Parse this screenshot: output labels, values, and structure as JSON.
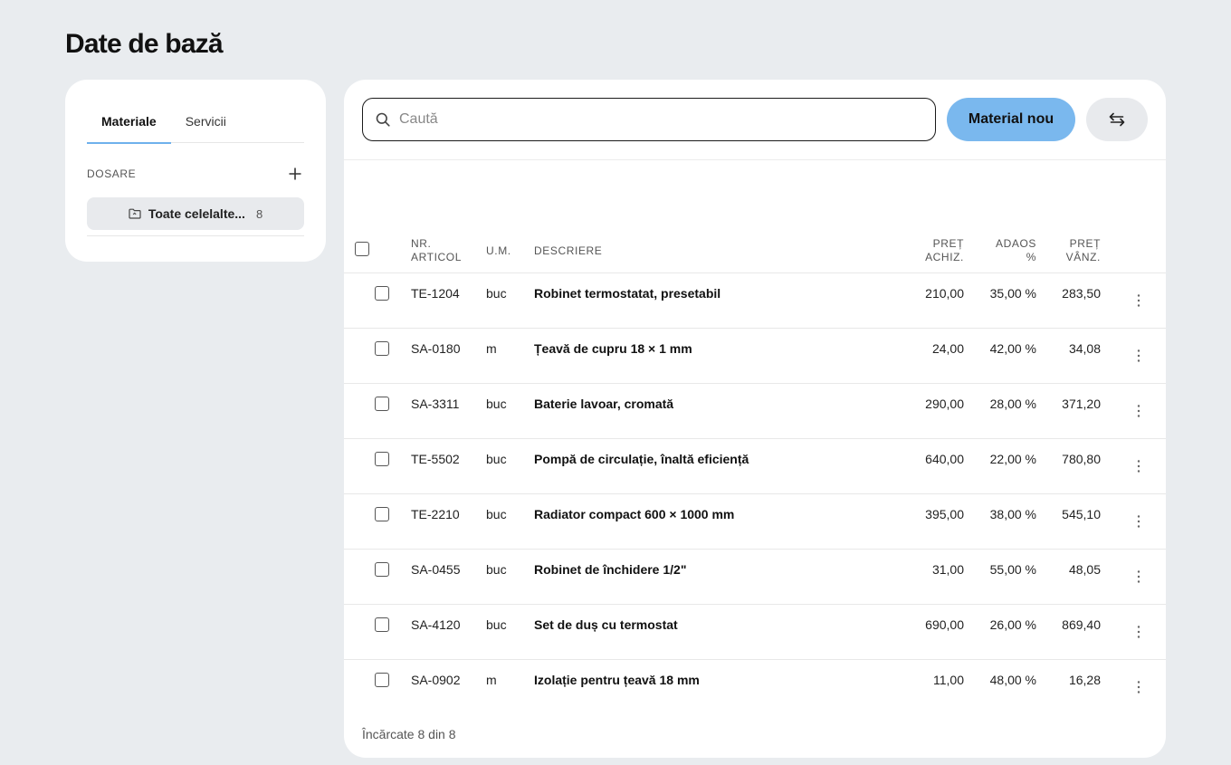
{
  "page": {
    "title": "Date de bază"
  },
  "sidebar": {
    "tabs": [
      {
        "label": "Materiale",
        "active": true
      },
      {
        "label": "Servicii",
        "active": false
      }
    ],
    "folders_label": "DOSARE",
    "folder": {
      "name": "Toate celelalte...",
      "count": "8"
    }
  },
  "toolbar": {
    "search_placeholder": "Caută",
    "new_material_label": "Material nou"
  },
  "table": {
    "headers": {
      "article_1": "NR.",
      "article_2": "ARTICOL",
      "unit": "U.M.",
      "description": "DESCRIERE",
      "buy_1": "PREȚ",
      "buy_2": "ACHIZ.",
      "markup_1": "ADAOS",
      "markup_2": "%",
      "sell_1": "PREȚ",
      "sell_2": "VÂNZ."
    },
    "rows": [
      {
        "article": "TE-1204",
        "unit": "buc",
        "description": "Robinet termostatat, presetabil",
        "buy": "210,00",
        "markup": "35,00 %",
        "sell": "283,50"
      },
      {
        "article": "SA-0180",
        "unit": "m",
        "description": "Țeavă de cupru 18 × 1 mm",
        "buy": "24,00",
        "markup": "42,00 %",
        "sell": "34,08"
      },
      {
        "article": "SA-3311",
        "unit": "buc",
        "description": "Baterie lavoar, cromată",
        "buy": "290,00",
        "markup": "28,00 %",
        "sell": "371,20"
      },
      {
        "article": "TE-5502",
        "unit": "buc",
        "description": "Pompă de circulație, înaltă eficiență",
        "buy": "640,00",
        "markup": "22,00 %",
        "sell": "780,80"
      },
      {
        "article": "TE-2210",
        "unit": "buc",
        "description": "Radiator compact 600 × 1000 mm",
        "buy": "395,00",
        "markup": "38,00 %",
        "sell": "545,10"
      },
      {
        "article": "SA-0455",
        "unit": "buc",
        "description": "Robinet de închidere 1/2\"",
        "buy": "31,00",
        "markup": "55,00 %",
        "sell": "48,05"
      },
      {
        "article": "SA-4120",
        "unit": "buc",
        "description": "Set de duș cu termostat",
        "buy": "690,00",
        "markup": "26,00 %",
        "sell": "869,40"
      },
      {
        "article": "SA-0902",
        "unit": "m",
        "description": "Izolație pentru țeavă 18 mm",
        "buy": "11,00",
        "markup": "48,00 %",
        "sell": "16,28"
      }
    ],
    "footer": "Încărcate 8 din 8"
  },
  "icons": {
    "search": "search-icon",
    "folder": "folder-icon",
    "add": "plus-icon",
    "swap": "swap-arrows-icon",
    "more": "more-vertical-icon"
  },
  "colors": {
    "accent": "#7ab8ee",
    "tab_underline": "#6fb1ec",
    "background": "#e9ecef"
  }
}
